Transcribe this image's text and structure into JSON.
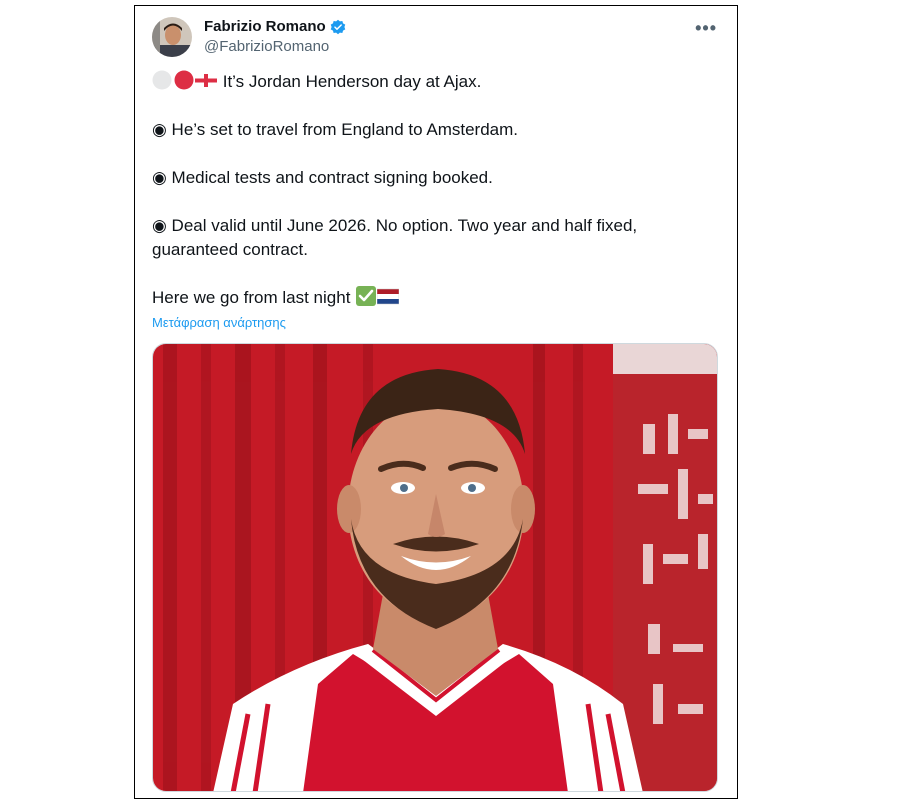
{
  "tweet": {
    "author_name": "Fabrizio Romano",
    "author_handle": "@FabrizioRomano",
    "verified": true,
    "more_label": "•••",
    "paragraphs": {
      "p1": "It’s Jordan Henderson day at Ajax.",
      "p2": "◉ He’s set to travel from England to Amsterdam.",
      "p3": "◉ Medical tests and contract signing booked.",
      "p4": "◉ Deal valid until June 2026. No option. Two year and half fixed, guaranteed contract.",
      "p5": "Here we go from last night"
    },
    "translate_link": "Μετάφραση ανάρτησης"
  },
  "colors": {
    "accent": "#1d9bf0",
    "text": "#0f1419",
    "secondary": "#536471",
    "ajax_red": "#d2122e"
  },
  "icons": [
    "verified-badge-icon",
    "more-options-icon",
    "white-circle-emoji",
    "red-circle-emoji",
    "england-flag-emoji",
    "check-mark-emoji",
    "netherlands-flag-emoji"
  ]
}
